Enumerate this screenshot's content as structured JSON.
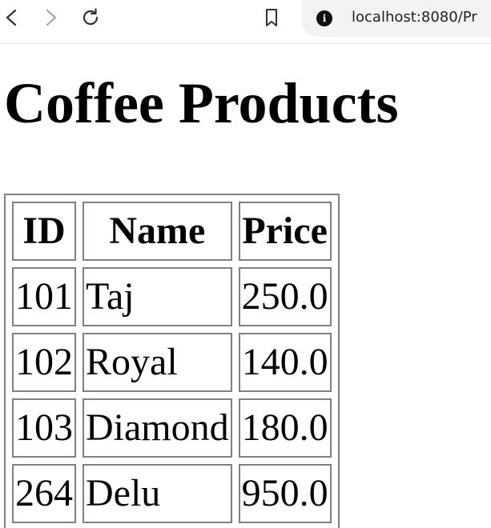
{
  "browser": {
    "url": "localhost:8080/Pr",
    "icons": [
      "back-arrow",
      "forward-arrow",
      "reload",
      "bookmark",
      "site-info"
    ]
  },
  "page": {
    "title": "Coffee Products"
  },
  "table": {
    "headers": [
      "ID",
      "Name",
      "Price"
    ],
    "rows": [
      [
        "101",
        "Taj",
        "250.0"
      ],
      [
        "102",
        "Royal",
        "140.0"
      ],
      [
        "103",
        "Diamond",
        "180.0"
      ],
      [
        "264",
        "Delu",
        "950.0"
      ]
    ]
  }
}
